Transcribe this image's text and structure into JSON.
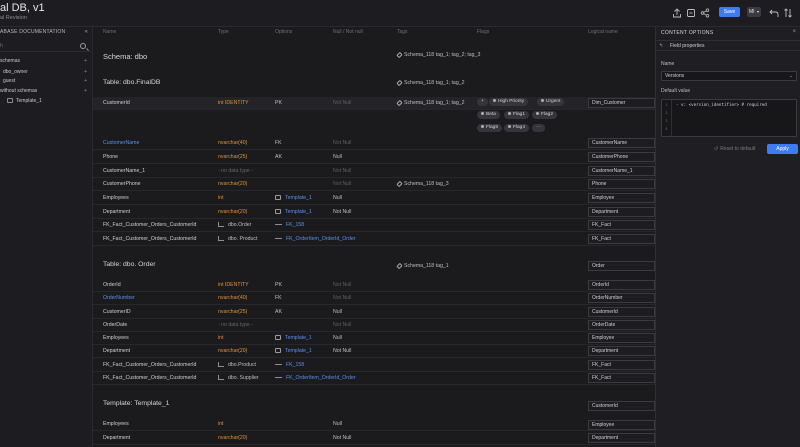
{
  "header": {
    "title": "al DB, v1",
    "subtitle": "al Revision",
    "save_label": "Save",
    "avatar_initials": "MI"
  },
  "sidebar": {
    "title": "ABASE DOCUMENTATION",
    "search_placeholder": "h",
    "items": [
      {
        "label": "schemas"
      },
      {
        "label": "dbo_owner"
      },
      {
        "label": "guest"
      },
      {
        "label": "without schemas"
      },
      {
        "label": "Template_1"
      }
    ]
  },
  "columns": {
    "name": "Name",
    "type": "Type",
    "options": "Options",
    "null": "Null / Not null",
    "tags": "Tags",
    "flags": "Flags",
    "logical": "Logical name"
  },
  "schema": {
    "title": "Schema: dbo",
    "tags": "Schema_118 tag_1; tag_2; tag_3"
  },
  "final_table": {
    "title": "Table: dbo.FinalDB",
    "tags": "Schema_118 tag_1; tag_2",
    "rows": [
      {
        "name": "CustomerId",
        "type": "int IDENTITY",
        "option": "PK",
        "null": "Not Null",
        "tag": "Schema_118 tag_1; tag_2",
        "logical": "Dim_Customer"
      },
      {
        "name": "CustomerName",
        "type": "nvarchar(40)",
        "option": "FK",
        "null": "Not Null",
        "tag": "",
        "logical": "CustomerName"
      },
      {
        "name": "Phone",
        "type": "nvarchar(25)",
        "option": "AK",
        "null": "Null",
        "tag": "",
        "logical": "CustomerPhone"
      },
      {
        "name": "CustomerName_1",
        "type": "- no data type -",
        "option": "",
        "null": "Not Null",
        "tag": "",
        "logical": "CustomerName_1"
      },
      {
        "name": "CustomerPhone",
        "type": "nvarchar(20)",
        "option": "",
        "null": "Not Null",
        "tag": "Schema_118 tag_3",
        "logical": "Phone"
      },
      {
        "name": "Employees",
        "type": "int",
        "option": "Template_1",
        "null": "Null",
        "tag": "",
        "logical": "Employee"
      },
      {
        "name": "Department",
        "type": "nvarchar(20)",
        "option": "Template_1",
        "null": "Not Null",
        "tag": "",
        "logical": "Department"
      },
      {
        "name": "FK_Fact_Customer_Orders_CustomerId",
        "type": "dbo.Order",
        "option": "FK_158",
        "null": "",
        "tag": "",
        "logical": "FK_Fact"
      },
      {
        "name": "FK_Fact_Customer_Orders_CustomerId",
        "type": "dbo. Product",
        "option": "FK_OrderItem_OrderId_Order",
        "null": "",
        "tag": "",
        "logical": "FK_Fact"
      }
    ]
  },
  "flags": [
    "High Priority",
    "Urgent",
    "Beta",
    "Flag1",
    "Flag2",
    "Flag5",
    "Flag4"
  ],
  "order_table": {
    "title": "Table: dbo. Order",
    "tags": "Schema_118 tag_1",
    "logical": "Order",
    "rows": [
      {
        "name": "OrderId",
        "type": "int IDENTITY",
        "option": "PK",
        "null": "Not Null",
        "logical": "OrderId"
      },
      {
        "name": "OrderNumber",
        "type": "nvarchar(40)",
        "option": "FK",
        "null": "Not Null",
        "logical": "OrderNumber"
      },
      {
        "name": "CustomerID",
        "type": "nvarchar(25)",
        "option": "AK",
        "null": "Null",
        "logical": "CustomerId"
      },
      {
        "name": "OrderDate",
        "type": "- no data type -",
        "option": "",
        "null": "Not Null",
        "logical": "OrderDate"
      },
      {
        "name": "Employees",
        "type": "int",
        "option": "Template_1",
        "null": "Null",
        "logical": "Employee"
      },
      {
        "name": "Department",
        "type": "nvarchar(20)",
        "option": "Template_1",
        "null": "Not Null",
        "logical": "Department"
      },
      {
        "name": "FK_Fact_Customer_Orders_CustomerId",
        "type": "dbo.Product",
        "option": "FK_158",
        "null": "",
        "logical": "FK_Fact"
      },
      {
        "name": "FK_Fact_Customer_Orders_CustomerId",
        "type": "dbo. Supplier",
        "option": "FK_OrderItem_OrderId_Order",
        "null": "",
        "logical": "FK_Fact"
      }
    ]
  },
  "template_section": {
    "title": "Template: Template_1",
    "logical": "CustomerId",
    "rows": [
      {
        "name": "Employees",
        "type": "int",
        "option": "",
        "null": "Null",
        "logical": "Employee"
      },
      {
        "name": "Department",
        "type": "nvarchar(20)",
        "option": "",
        "null": "Not Null",
        "logical": "Department"
      }
    ]
  },
  "right_panel": {
    "title": "CONTENT OPTIONS",
    "field_properties": "Field properties",
    "name_label": "Name",
    "name_value": "Versions",
    "default_label": "Default value",
    "code_line": "- v: <version_identifier> # required",
    "gutter": [
      "1",
      "2",
      "3",
      "4"
    ],
    "reset_label": "Reset to default",
    "apply_label": "Apply"
  },
  "colors": {
    "accent": "#3d7df1",
    "type_orange": "#e0903c",
    "link_blue": "#5b8fe8",
    "background": "#1b1b1e"
  }
}
